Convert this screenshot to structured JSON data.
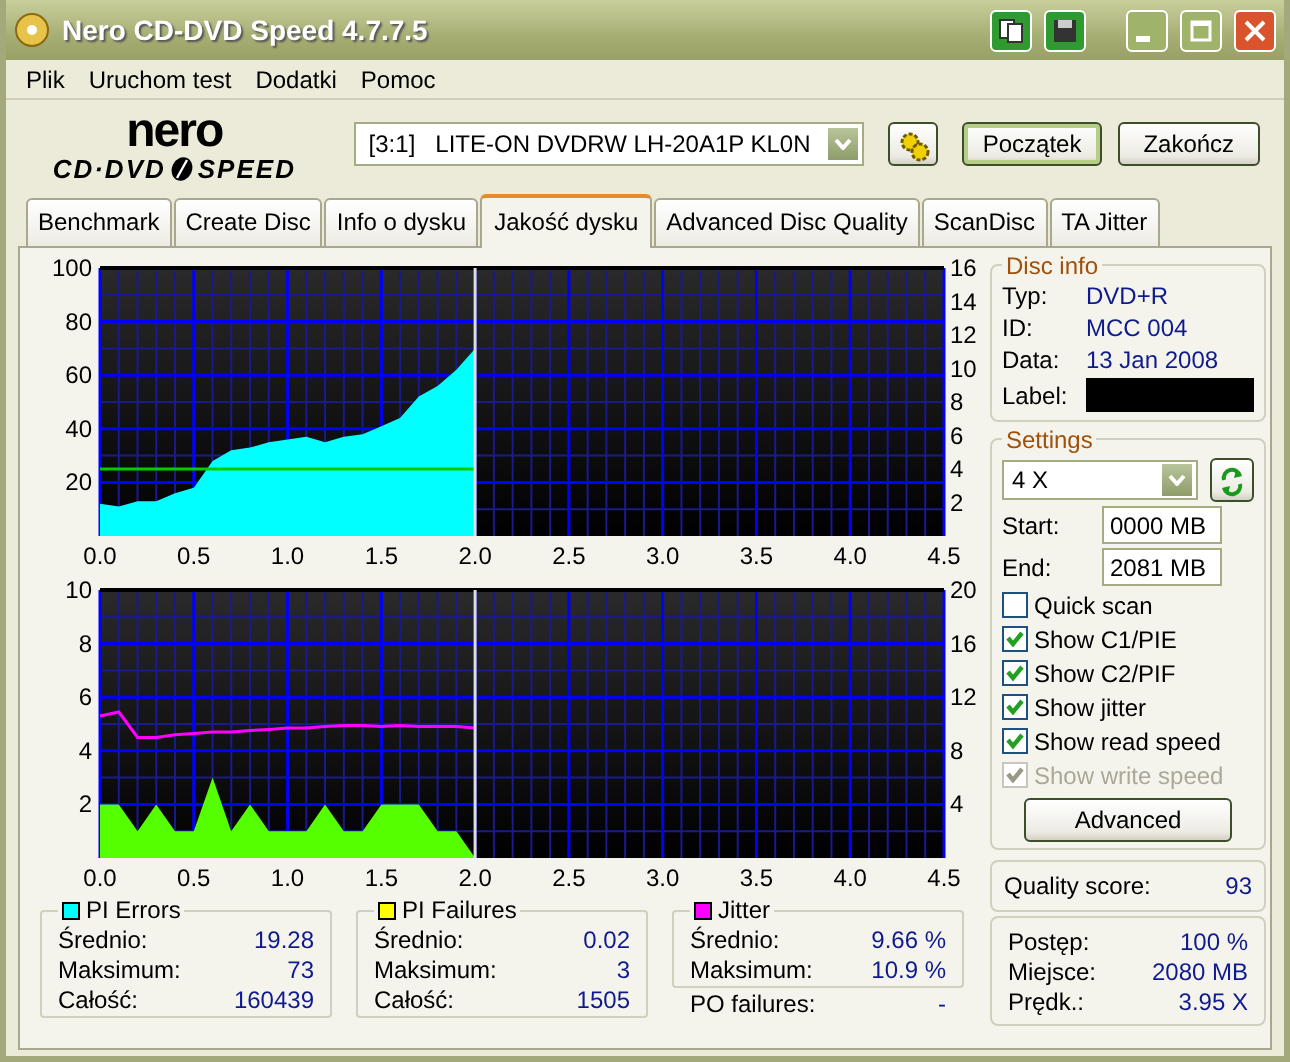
{
  "window": {
    "title": "Nero CD-DVD Speed 4.7.7.5"
  },
  "menu": [
    "Plik",
    "Uruchom test",
    "Dodatki",
    "Pomoc"
  ],
  "toolbar": {
    "logo_top": "nero",
    "logo_left": "CD·DVD",
    "logo_right": "SPEED",
    "drive": "[3:1]   LITE-ON DVDRW LH-20A1P KL0N",
    "buttons": [
      "Początek",
      "Zakończ"
    ]
  },
  "tabs": [
    {
      "label": "Benchmark",
      "selected": false
    },
    {
      "label": "Create Disc",
      "selected": false
    },
    {
      "label": "Info o dysku",
      "selected": false
    },
    {
      "label": "Jakość dysku",
      "selected": true
    },
    {
      "label": "Advanced Disc Quality",
      "selected": false
    },
    {
      "label": "ScanDisc",
      "selected": false
    },
    {
      "label": "TA Jitter",
      "selected": false
    }
  ],
  "charts": [
    {
      "chart_data": {
        "type": "area",
        "x": [
          0,
          0.1,
          0.2,
          0.3,
          0.4,
          0.5,
          0.6,
          0.7,
          0.8,
          0.9,
          1.0,
          1.1,
          1.2,
          1.3,
          1.4,
          1.5,
          1.6,
          1.7,
          1.8,
          1.9,
          2.0
        ],
        "series": [
          {
            "color": "#00ffff",
            "values": [
              12,
              11,
              13,
              13,
              16,
              18,
              28,
              32,
              33,
              35,
              36,
              37,
              35,
              37,
              38,
              41,
              44,
              52,
              56,
              62,
              70
            ]
          },
          {
            "type": "line",
            "color": "#00cc00",
            "values": [
              25,
              25,
              25,
              25,
              25,
              25,
              25,
              25,
              25,
              25,
              25,
              25,
              25,
              25,
              25,
              25,
              25,
              25,
              25,
              25,
              25
            ]
          }
        ],
        "xlim": [
          0,
          4.5
        ],
        "ylim": [
          0,
          100
        ],
        "xticks": [
          {
            "value": 0,
            "label": "0.0"
          },
          {
            "value": 0.5,
            "label": "0.5"
          },
          {
            "value": 1,
            "label": "1.0"
          },
          {
            "value": 1.5,
            "label": "1.5"
          },
          {
            "value": 2,
            "label": "2.0"
          },
          {
            "value": 2.5,
            "label": "2.5"
          },
          {
            "value": 3,
            "label": "3.0"
          },
          {
            "value": 3.5,
            "label": "3.5"
          },
          {
            "value": 4,
            "label": "4.0"
          },
          {
            "value": 4.5,
            "label": "4.5"
          }
        ],
        "yticks": [
          20,
          40,
          60,
          80,
          100
        ],
        "grid": true,
        "ref_lines": [
          {
            "axis": "x",
            "value": 2.0,
            "color": "#dddddd"
          }
        ]
      },
      "right_axis_labels": [
        "16",
        "14",
        "12",
        "10",
        "8",
        "6",
        "4",
        "2"
      ]
    },
    {
      "chart_data": {
        "type": "area",
        "x": [
          0,
          0.1,
          0.2,
          0.3,
          0.4,
          0.5,
          0.6,
          0.7,
          0.8,
          0.9,
          1.0,
          1.1,
          1.2,
          1.3,
          1.4,
          1.5,
          1.6,
          1.7,
          1.8,
          1.9,
          2.0
        ],
        "series": [
          {
            "color": "#55ff00",
            "values": [
              2,
              2,
              1,
              2,
              1,
              1,
              3,
              1,
              2,
              1,
              1,
              1,
              2,
              1,
              1,
              2,
              2,
              2,
              1,
              1,
              0
            ]
          },
          {
            "type": "line",
            "color": "#ff00ff",
            "values": [
              5.3,
              5.45,
              4.5,
              4.5,
              4.6,
              4.65,
              4.7,
              4.7,
              4.75,
              4.8,
              4.85,
              4.85,
              4.9,
              4.95,
              4.95,
              4.9,
              4.95,
              4.9,
              4.9,
              4.9,
              4.85
            ]
          }
        ],
        "xlim": [
          0,
          4.5
        ],
        "ylim": [
          0,
          10
        ],
        "xticks": [
          {
            "value": 0,
            "label": "0.0"
          },
          {
            "value": 0.5,
            "label": "0.5"
          },
          {
            "value": 1,
            "label": "1.0"
          },
          {
            "value": 1.5,
            "label": "1.5"
          },
          {
            "value": 2,
            "label": "2.0"
          },
          {
            "value": 2.5,
            "label": "2.5"
          },
          {
            "value": 3,
            "label": "3.0"
          },
          {
            "value": 3.5,
            "label": "3.5"
          },
          {
            "value": 4,
            "label": "4.0"
          },
          {
            "value": 4.5,
            "label": "4.5"
          }
        ],
        "yticks": [
          2,
          4,
          6,
          8,
          10
        ],
        "grid": true,
        "ref_lines": [
          {
            "axis": "x",
            "value": 2.0,
            "color": "#dddddd"
          }
        ]
      },
      "right_axis_labels": [
        "20",
        "16",
        "12",
        "8",
        "4"
      ]
    }
  ],
  "disc_info": {
    "title": "Disc info",
    "rows": [
      {
        "label": "Typ:",
        "kind": "text",
        "value": "DVD+R"
      },
      {
        "label": "ID:",
        "kind": "text",
        "value": "MCC 004"
      },
      {
        "label": "Data:",
        "kind": "text",
        "value": "13 Jan 2008"
      },
      {
        "label": "Label:",
        "kind": "redacted"
      }
    ]
  },
  "settings": {
    "title": "Settings",
    "speed": "4 X",
    "fields": [
      {
        "label": "Start:",
        "value": "0000 MB"
      },
      {
        "label": "End:",
        "value": "2081 MB"
      }
    ],
    "options": [
      {
        "label": "Quick scan",
        "checked": false,
        "disabled": false
      },
      {
        "label": "Show C1/PIE",
        "checked": true,
        "disabled": false
      },
      {
        "label": "Show C2/PIF",
        "checked": true,
        "disabled": false
      },
      {
        "label": "Show jitter",
        "checked": true,
        "disabled": false
      },
      {
        "label": "Show read speed",
        "checked": true,
        "disabled": false
      },
      {
        "label": "Show write speed",
        "checked": true,
        "disabled": true
      }
    ],
    "button": "Advanced"
  },
  "quality": {
    "label": "Quality score:",
    "value": "93"
  },
  "stats": [
    {
      "title": "PI Errors",
      "color": "#00ffff",
      "rows": [
        {
          "label": "Średnio:",
          "value": "19.28"
        },
        {
          "label": "Maksimum:",
          "value": "73"
        },
        {
          "label": "Całość:",
          "value": "160439"
        }
      ]
    },
    {
      "title": "PI Failures",
      "color": "#ffff00",
      "rows": [
        {
          "label": "Średnio:",
          "value": "0.02"
        },
        {
          "label": "Maksimum:",
          "value": "3"
        },
        {
          "label": "Całość:",
          "value": "1505"
        }
      ]
    },
    {
      "title": "Jitter",
      "color": "#ff00ff",
      "rows": [
        {
          "label": "Średnio:",
          "value": "9.66 %"
        },
        {
          "label": "Maksimum:",
          "value": "10.9 %"
        }
      ]
    }
  ],
  "po_failures": {
    "label": "PO failures:",
    "value": "-"
  },
  "progress": [
    {
      "label": "Postęp:",
      "value": "100 %"
    },
    {
      "label": "Miejsce:",
      "value": "2080 MB"
    },
    {
      "label": "Prędk.:",
      "value": "3.95 X"
    }
  ]
}
